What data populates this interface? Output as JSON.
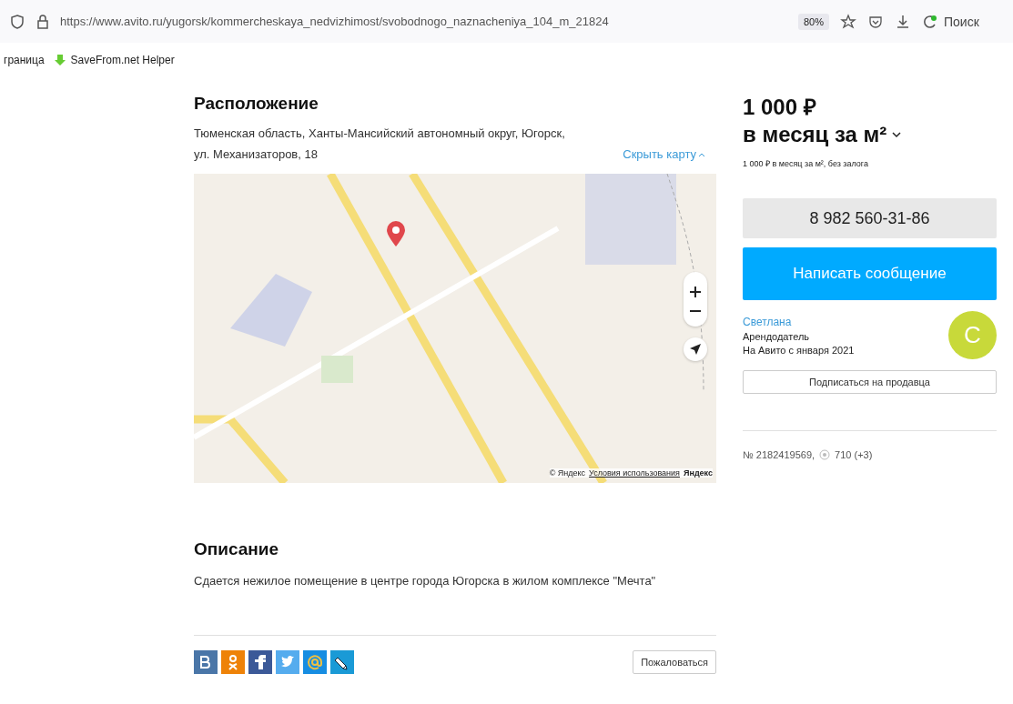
{
  "browser": {
    "url": "https://www.avito.ru/yugorsk/kommercheskaya_nedvizhimost/svobodnogo_naznacheniya_104_m_21824",
    "zoom": "80%",
    "search_label": "Поиск",
    "bookmarks": [
      "граница",
      "SaveFrom.net Helper"
    ]
  },
  "location": {
    "title": "Расположение",
    "address_line1": "Тюменская область, Ханты-Мансийский автономный округ, Югорск,",
    "address_line2": "ул. Механизаторов, 18",
    "hide_map": "Скрыть карту",
    "attribution": "© Яндекс",
    "terms": "Условия использования",
    "map_logo": "Яндекс"
  },
  "description": {
    "title": "Описание",
    "text": "Сдается нежилое помещение в центре города Югорска в жилом комплексе \"Мечта\""
  },
  "share": [
    {
      "kind": "vk",
      "color": "#4a76a8"
    },
    {
      "kind": "ok",
      "color": "#ee8208"
    },
    {
      "kind": "fb",
      "color": "#3b5998"
    },
    {
      "kind": "tw",
      "color": "#55acee"
    },
    {
      "kind": "mail",
      "color": "#168de2"
    },
    {
      "kind": "lj",
      "color": "#1a9ad6"
    }
  ],
  "report_button": "Пожаловаться",
  "price": {
    "amount": "1 000 ₽",
    "unit": "в месяц за м²",
    "note": "1 000 ₽ в месяц за м², без залога"
  },
  "phone_button": "8 982 560-31-86",
  "message_button": "Написать сообщение",
  "seller": {
    "name": "Светлана",
    "role": "Арендодатель",
    "since": "На Авито с января 2021",
    "avatar_letter": "С",
    "subscribe": "Подписаться на продавца"
  },
  "listing": {
    "number": "№ 2182419569,",
    "views": "710 (+3)"
  }
}
